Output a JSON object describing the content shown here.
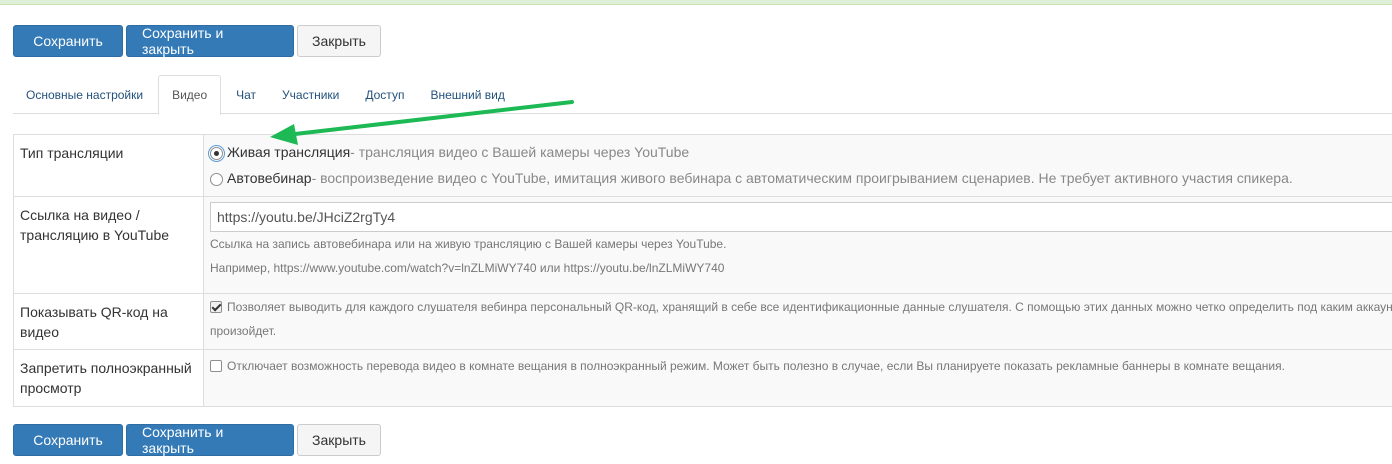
{
  "toolbar": {
    "save": "Сохранить",
    "save_close": "Сохранить и закрыть",
    "close": "Закрыть"
  },
  "tabs": [
    {
      "label": "Основные настройки"
    },
    {
      "label": "Видео",
      "active": true
    },
    {
      "label": "Чат"
    },
    {
      "label": "Участники"
    },
    {
      "label": "Доступ"
    },
    {
      "label": "Внешний вид"
    }
  ],
  "form": {
    "broadcast_type": {
      "label": "Тип трансляции",
      "options": [
        {
          "name": "Живая трансляция",
          "desc": " - трансляция видео с Вашей камеры через YouTube",
          "selected": true
        },
        {
          "name": "Автовебинар",
          "desc": " - воспроизведение видео с YouTube, имитация живого вебинара с автоматическим проигрыванием сценариев. Не требует активного участия спикера.",
          "selected": false
        }
      ]
    },
    "video_link": {
      "label": "Ссылка на видео / трансляцию в YouTube",
      "value": "https://youtu.be/JHciZ2rgTy4",
      "help1": "Ссылка на запись автовебинара или на живую трансляцию с Вашей камеры через YouTube.",
      "help2": "Например, https://www.youtube.com/watch?v=lnZLMiWY740 или https://youtu.be/lnZLMiWY740"
    },
    "qr_code": {
      "label": "Показывать QR-код на видео",
      "checked": true,
      "desc_line1": "Позволяет выводить для каждого слушателя вебинра персональный QR-код, хранящий в себе все идентификационные данные слушателя. С помощью этих данных можно четко определить под каким аккаунт",
      "desc_line2": "произойдет."
    },
    "fullscreen": {
      "label": "Запретить полноэкранный просмотр",
      "checked": false,
      "desc": "Отключает возможность перевода видео в комнате вещания в полноэкранный режим. Может быть полезно в случае, если Вы планируете показать рекламные баннеры в комнате вещания."
    }
  },
  "annotation": {
    "arrow_color": "#1db954"
  },
  "colors": {
    "primary": "#337ab7",
    "success_strip": "#dff0d8"
  }
}
